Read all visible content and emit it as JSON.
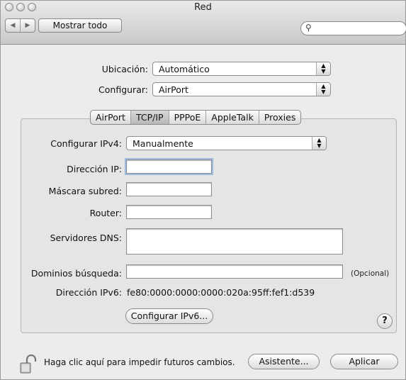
{
  "window": {
    "title": "Red"
  },
  "toolbar": {
    "back_icon": "back-arrow-icon",
    "forward_icon": "forward-arrow-icon",
    "show_all_label": "Mostrar todo",
    "search_value": "",
    "search_icon": "magnifier-icon"
  },
  "location": {
    "label": "Ubicación:",
    "value": "Automático"
  },
  "configure": {
    "label": "Configurar:",
    "value": "AirPort"
  },
  "tabs": [
    {
      "label": "AirPort",
      "selected": false
    },
    {
      "label": "TCP/IP",
      "selected": true
    },
    {
      "label": "PPPoE",
      "selected": false
    },
    {
      "label": "AppleTalk",
      "selected": false
    },
    {
      "label": "Proxies",
      "selected": false
    }
  ],
  "tcpip": {
    "ipv4_label": "Configurar IPv4:",
    "ipv4_value": "Manualmente",
    "ip_label": "Dirección IP:",
    "ip_value": "",
    "mask_label": "Máscara subred:",
    "mask_value": "",
    "router_label": "Router:",
    "router_value": "",
    "dns_label": "Servidores DNS:",
    "dns_value": "",
    "search_domains_label": "Dominios búsqueda:",
    "search_domains_value": "",
    "optional_label": "(Opcional)",
    "ipv6_label": "Dirección IPv6:",
    "ipv6_value": "fe80:0000:0000:0000:020a:95ff:fef1:d539",
    "configure_ipv6_label": "Configurar IPv6...",
    "help_label": "?"
  },
  "footer": {
    "lock_icon": "padlock-open-icon",
    "lock_message": "Haga clic aquí para impedir futuros cambios.",
    "assistant_label": "Asistente...",
    "apply_label": "Aplicar"
  }
}
